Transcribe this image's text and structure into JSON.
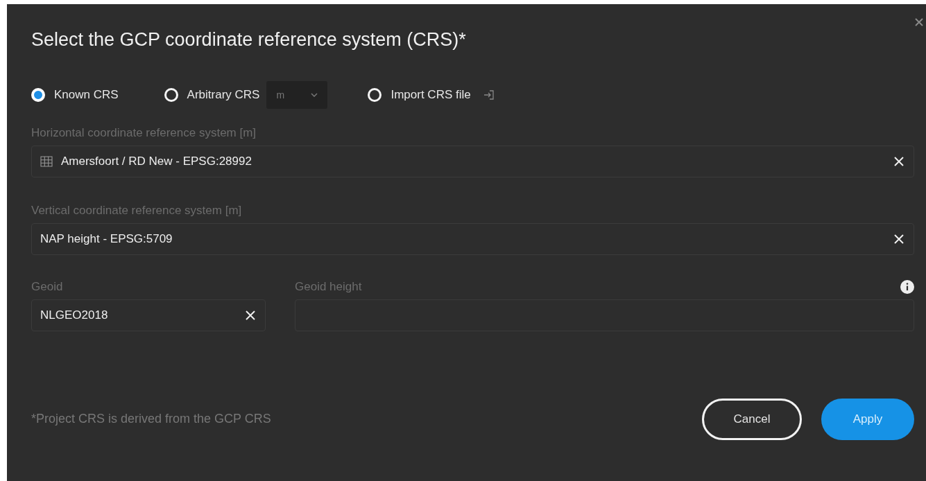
{
  "dialog": {
    "title": "Select the GCP coordinate reference system (CRS)*"
  },
  "crs_options": [
    {
      "label": "Known CRS",
      "selected": true,
      "kind": "plain"
    },
    {
      "label": "Arbitrary CRS",
      "selected": false,
      "kind": "unit",
      "unit": "m"
    },
    {
      "label": "Import CRS file",
      "selected": false,
      "kind": "import"
    }
  ],
  "horizontal": {
    "label": "Horizontal coordinate reference system [m]",
    "value": "Amersfoort / RD New - EPSG:28992"
  },
  "vertical": {
    "label": "Vertical coordinate reference system [m]",
    "value": "NAP height - EPSG:5709"
  },
  "geoid": {
    "label": "Geoid",
    "value": "NLGEO2018"
  },
  "geoid_height": {
    "label": "Geoid height"
  },
  "footnote": "*Project CRS is derived from the GCP CRS",
  "buttons": [
    {
      "label": "Cancel",
      "kind": "secondary"
    },
    {
      "label": "Apply",
      "kind": "primary"
    }
  ]
}
